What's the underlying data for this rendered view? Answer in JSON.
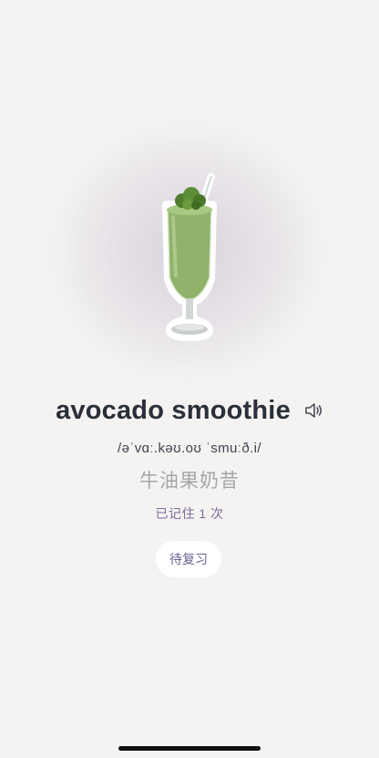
{
  "card": {
    "word": "avocado smoothie",
    "phonetic": "/əˈvɑː.kəʊ.oʊ ˈsmuːð.i/",
    "translation": "牛油果奶昔",
    "memory_count_text": "已记住 1 次",
    "status_label": "待复习"
  },
  "icons": {
    "speaker": "speaker-icon",
    "illustration": "avocado-smoothie-illustration"
  },
  "colors": {
    "background": "#f4f3f1",
    "word": "#2a2f3a",
    "translation": "#a4a6ab",
    "accent_purple": "#7a6c9c",
    "smoothie_green": "#8fb36a"
  }
}
